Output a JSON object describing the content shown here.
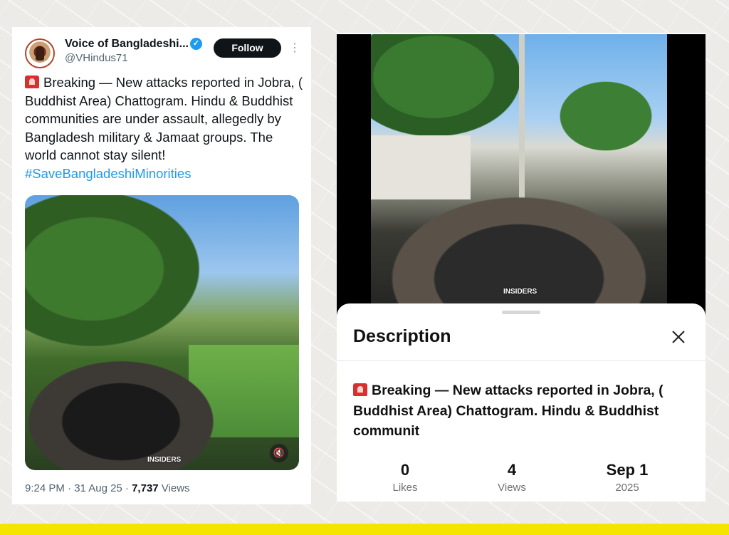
{
  "tweet": {
    "display_name": "Voice of Bangladeshi...",
    "verified_mark": "✓",
    "handle": "@VHindus71",
    "follow_label": "Follow",
    "more_icon": "⋮",
    "text_body": "Breaking — New attacks reported in Jobra, ( Buddhist Area) Chattogram. Hindu & Buddhist communities are under assault, allegedly by Bangladesh military & Jamaat groups. The world cannot stay silent!",
    "hashtag": "#SaveBangladeshiMinorities",
    "media_watermark": "INSIDERS",
    "mute_icon": "🔇",
    "time": "9:24 PM · 31 Aug 25 · ",
    "views_count": "7,737",
    "views_label": " Views"
  },
  "video_panel": {
    "watermark": "INSIDERS"
  },
  "description_sheet": {
    "title": "Description",
    "text": "Breaking — New attacks reported in Jobra, ( Buddhist Area) Chattogram. Hindu & Buddhist communit",
    "stats": [
      {
        "value": "0",
        "label": "Likes"
      },
      {
        "value": "4",
        "label": "Views"
      },
      {
        "value": "Sep 1",
        "label": "2025"
      }
    ]
  },
  "colors": {
    "accent_link": "#1d9bf0",
    "follow_button": "#0f1419",
    "siren": "#d9302e",
    "bottom_bar": "#f5e300"
  }
}
